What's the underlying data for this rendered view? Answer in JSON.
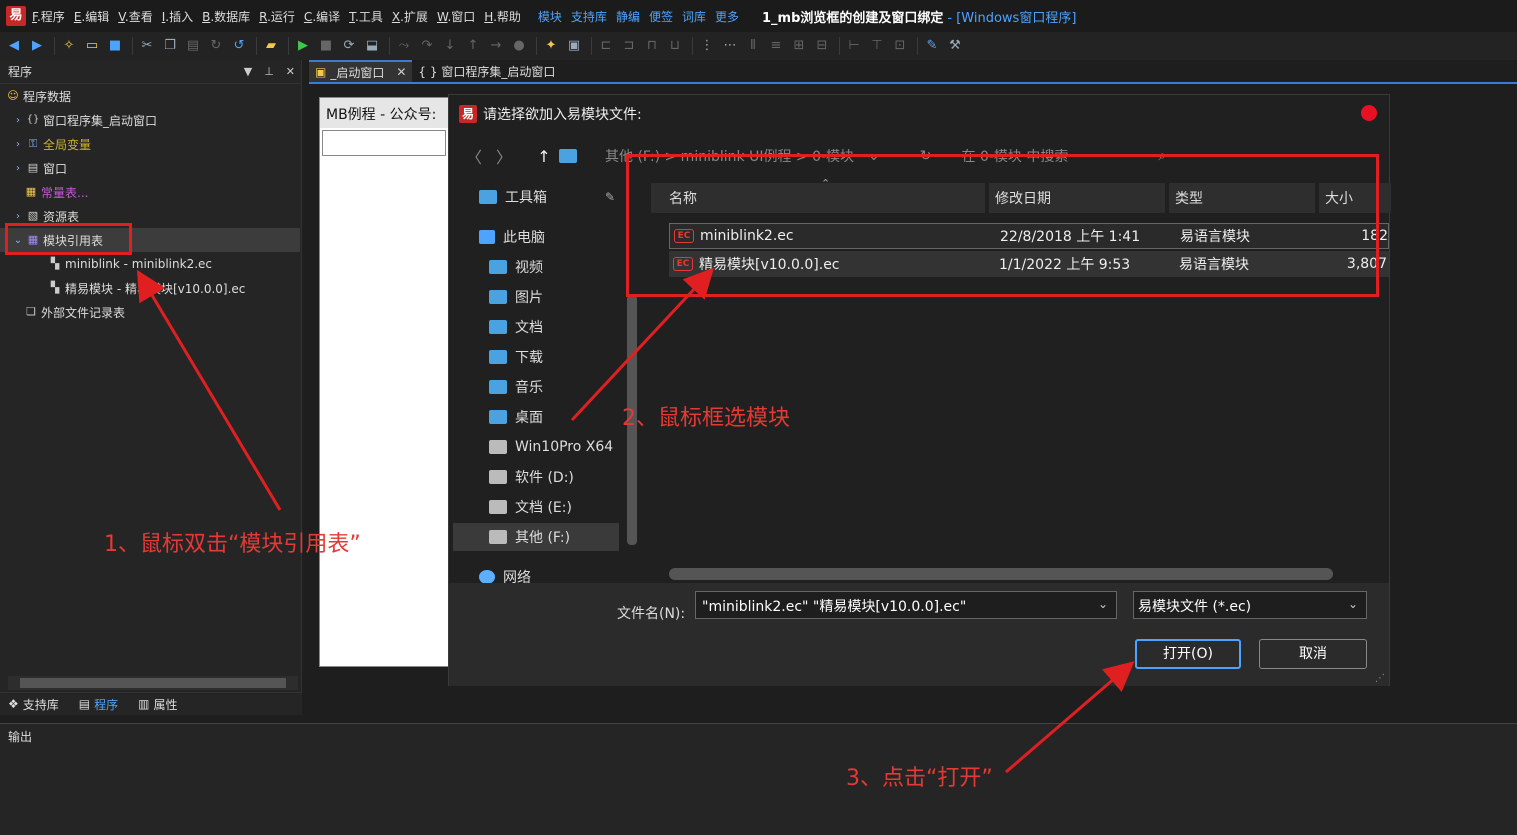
{
  "app": {
    "logo": "易",
    "menus": [
      {
        "key": "F",
        "label": ".程序"
      },
      {
        "key": "E",
        "label": ".编辑"
      },
      {
        "key": "V",
        "label": ".查看"
      },
      {
        "key": "I",
        "label": ".插入"
      },
      {
        "key": "B",
        "label": ".数据库"
      },
      {
        "key": "R",
        "label": ".运行"
      },
      {
        "key": "C",
        "label": ".编译"
      },
      {
        "key": "T",
        "label": ".工具"
      },
      {
        "key": "X",
        "label": ".扩展"
      },
      {
        "key": "W",
        "label": ".窗口"
      },
      {
        "key": "H",
        "label": ".帮助"
      }
    ],
    "quick_links": [
      "模块",
      "支持库",
      "静编",
      "便签",
      "词库",
      "更多"
    ],
    "title": "1_mb浏览框的创建及窗口绑定",
    "title_suffix": "- [Windows窗口程序]"
  },
  "left_panel": {
    "header": "程序",
    "tree": [
      {
        "label": "程序数据",
        "icon": "smiley-icon"
      },
      {
        "label": "窗口程序集_启动窗口",
        "icon": "braces-icon"
      },
      {
        "label": "全局变量",
        "icon": "variable-icon"
      },
      {
        "label": "窗口",
        "icon": "window-icon"
      },
      {
        "label": "常量表...",
        "icon": "constant-icon"
      },
      {
        "label": "资源表",
        "icon": "resource-icon"
      },
      {
        "label": "模块引用表",
        "icon": "module-table-icon"
      },
      {
        "label": "miniblink - miniblink2.ec",
        "icon": "module-icon"
      },
      {
        "label": "精易模块 - 精易模块[v10.0.0].ec",
        "icon": "module-icon"
      },
      {
        "label": "外部文件记录表",
        "icon": "external-file-icon"
      }
    ],
    "tabs": [
      {
        "label": "支持库"
      },
      {
        "label": "程序"
      },
      {
        "label": "属性"
      }
    ]
  },
  "editor_tabs": [
    {
      "label": "_启动窗口"
    },
    {
      "label": "{ } 窗口程序集_启动窗口"
    }
  ],
  "form_preview": {
    "title": "MB例程 - 公众号:"
  },
  "output": {
    "title": "输出"
  },
  "dialog": {
    "title": "请选择欲加入易模块文件:",
    "breadcrumb": "其他 (F:)  >  miniblink UI例程  >  0-模块",
    "search_placeholder": "在 0-模块 中搜索",
    "nav_items": [
      {
        "label": "工具箱",
        "icon": "folder-icon"
      },
      {
        "label": "此电脑",
        "icon": "computer-icon"
      },
      {
        "label": "视频",
        "icon": "folder-icon"
      },
      {
        "label": "图片",
        "icon": "folder-icon"
      },
      {
        "label": "文档",
        "icon": "folder-icon"
      },
      {
        "label": "下载",
        "icon": "folder-icon"
      },
      {
        "label": "音乐",
        "icon": "folder-icon"
      },
      {
        "label": "桌面",
        "icon": "folder-icon"
      },
      {
        "label": "Win10Pro X64",
        "icon": "drive-icon"
      },
      {
        "label": "软件 (D:)",
        "icon": "drive-icon"
      },
      {
        "label": "文档 (E:)",
        "icon": "drive-icon"
      },
      {
        "label": "其他 (F:)",
        "icon": "drive-icon"
      },
      {
        "label": "网络",
        "icon": "network-icon"
      }
    ],
    "columns": [
      "名称",
      "修改日期",
      "类型",
      "大小"
    ],
    "files": [
      {
        "name": "miniblink2.ec",
        "date": "22/8/2018 上午 1:41",
        "type": "易语言模块",
        "size": "182"
      },
      {
        "name": "精易模块[v10.0.0].ec",
        "date": "1/1/2022 上午 9:53",
        "type": "易语言模块",
        "size": "3,807"
      }
    ],
    "filename_label": "文件名(N):",
    "filename_value": "\"miniblink2.ec\" \"精易模块[v10.0.0].ec\"",
    "filetype_value": "易模块文件 (*.ec)",
    "open_label": "打开(O)",
    "cancel_label": "取消"
  },
  "annotations": {
    "step1": "1、鼠标双击“模块引用表”",
    "step2": "2、鼠标框选模块",
    "step3": "3、点击“打开”"
  },
  "colors": {
    "annotation": "#e02020",
    "accent": "#4da3ff",
    "brand": "#c62828"
  }
}
